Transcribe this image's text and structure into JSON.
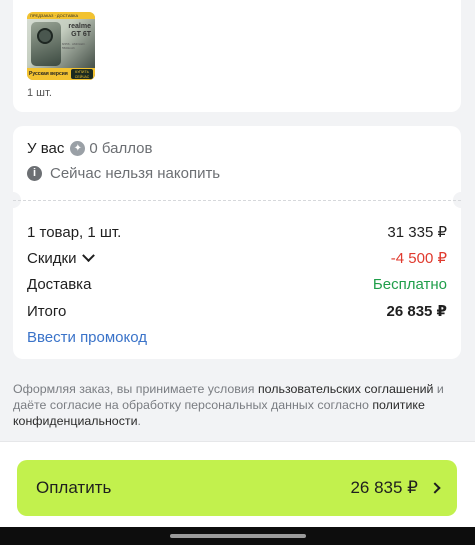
{
  "product": {
    "thumbnail": {
      "top_banner": "ПРЕДЗАКАЗ · ДОСТАВКА",
      "brand": "realme",
      "model": "GT 6T",
      "spec_lines": "8/256 · AMOLED · 5500mAh",
      "bottom_label": "Русская версия",
      "buy_badge": "КУПИТЬ СЕЙЧАС"
    },
    "quantity": "1 шт."
  },
  "points": {
    "prefix": "У вас",
    "icon": "points-icon",
    "value": "0 баллов",
    "info_icon": "info-icon",
    "info_text": "Сейчас нельзя накопить"
  },
  "summary": {
    "goods_label": "1 товар, 1 шт.",
    "goods_value": "31 335 ₽",
    "discount_label": "Скидки",
    "discount_value": "-4 500 ₽",
    "delivery_label": "Доставка",
    "delivery_value": "Бесплатно",
    "total_label": "Итого",
    "total_value": "26 835 ₽",
    "promo_link": "Ввести промокод"
  },
  "legal": {
    "part1": "Оформляя заказ, вы принимаете условия ",
    "link1": "пользовательских соглашений",
    "part2": " и даёте согласие на обработку персональных данных согласно ",
    "link2": "политике конфиденциальности",
    "part3": "."
  },
  "pay_button": {
    "label": "Оплатить",
    "amount": "26 835 ₽"
  },
  "colors": {
    "accent_button": "#c2f14d",
    "discount": "#e03a2e",
    "free": "#1f9e4a",
    "link": "#3a73c9"
  }
}
